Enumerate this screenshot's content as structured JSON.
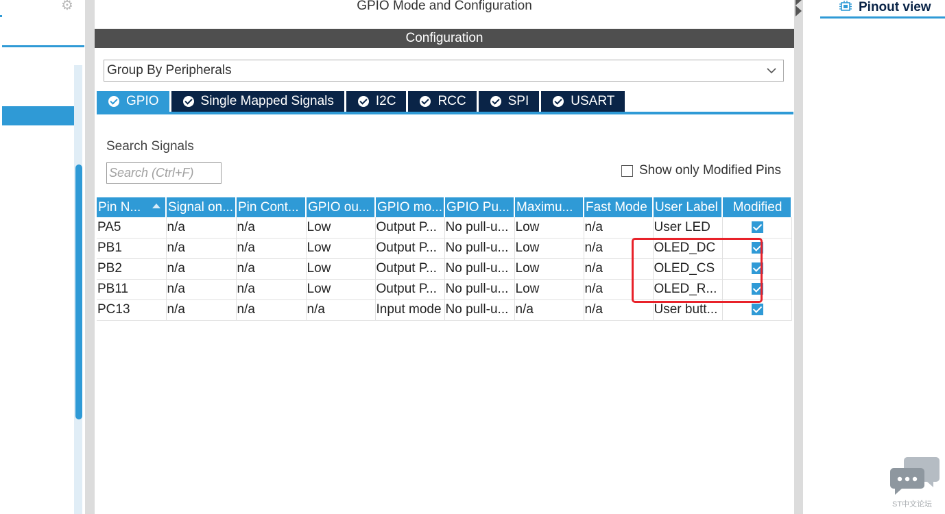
{
  "window": {
    "panel_title": "GPIO Mode and Configuration",
    "configuration_title": "Configuration",
    "pinout_tab_label": "Pinout view"
  },
  "group_by": {
    "selected": "Group By Peripherals"
  },
  "tabs": [
    {
      "label": "GPIO",
      "active": true
    },
    {
      "label": "Single Mapped Signals",
      "active": false
    },
    {
      "label": "I2C",
      "active": false
    },
    {
      "label": "RCC",
      "active": false
    },
    {
      "label": "SPI",
      "active": false
    },
    {
      "label": "USART",
      "active": false
    }
  ],
  "search": {
    "label": "Search Signals",
    "placeholder": "Search (Ctrl+F)",
    "value": ""
  },
  "show_modified": {
    "label": "Show only Modified Pins",
    "checked": false
  },
  "table": {
    "columns": [
      "Pin N...",
      "Signal on...",
      "Pin Cont...",
      "GPIO ou...",
      "GPIO mo...",
      "GPIO Pu...",
      "Maximu...",
      "Fast Mode",
      "User Label",
      "Modified"
    ],
    "rows": [
      {
        "pin": "PA5",
        "signal": "n/a",
        "pin_context": "n/a",
        "gpio_output": "Low",
        "gpio_mode": "Output P...",
        "gpio_pull": "No pull-u...",
        "max_speed": "Low",
        "fast_mode": "n/a",
        "user_label": "User LED",
        "modified": true
      },
      {
        "pin": "PB1",
        "signal": "n/a",
        "pin_context": "n/a",
        "gpio_output": "Low",
        "gpio_mode": "Output P...",
        "gpio_pull": "No pull-u...",
        "max_speed": "Low",
        "fast_mode": "n/a",
        "user_label": "OLED_DC",
        "modified": true
      },
      {
        "pin": "PB2",
        "signal": "n/a",
        "pin_context": "n/a",
        "gpio_output": "Low",
        "gpio_mode": "Output P...",
        "gpio_pull": "No pull-u...",
        "max_speed": "Low",
        "fast_mode": "n/a",
        "user_label": "OLED_CS",
        "modified": true
      },
      {
        "pin": "PB11",
        "signal": "n/a",
        "pin_context": "n/a",
        "gpio_output": "Low",
        "gpio_mode": "Output P...",
        "gpio_pull": "No pull-u...",
        "max_speed": "Low",
        "fast_mode": "n/a",
        "user_label": "OLED_R...",
        "modified": true
      },
      {
        "pin": "PC13",
        "signal": "n/a",
        "pin_context": "n/a",
        "gpio_output": "n/a",
        "gpio_mode": "Input mode",
        "gpio_pull": "No pull-u...",
        "max_speed": "n/a",
        "fast_mode": "n/a",
        "user_label": "User butt...",
        "modified": true
      }
    ]
  },
  "watermark": {
    "caption": "ST中文论坛",
    "icon": "chat-bubbles-icon"
  },
  "icons": {
    "settings": "gear-icon",
    "dropdown": "chevron-down-icon",
    "tab_status": "check-circle-icon",
    "sort": "sort-up-icon",
    "pinout": "chip-icon"
  },
  "colors": {
    "accent": "#2f9ad6",
    "tab_dark": "#0a2447",
    "config_bar": "#4f4f4f",
    "highlight": "#e8222a"
  }
}
